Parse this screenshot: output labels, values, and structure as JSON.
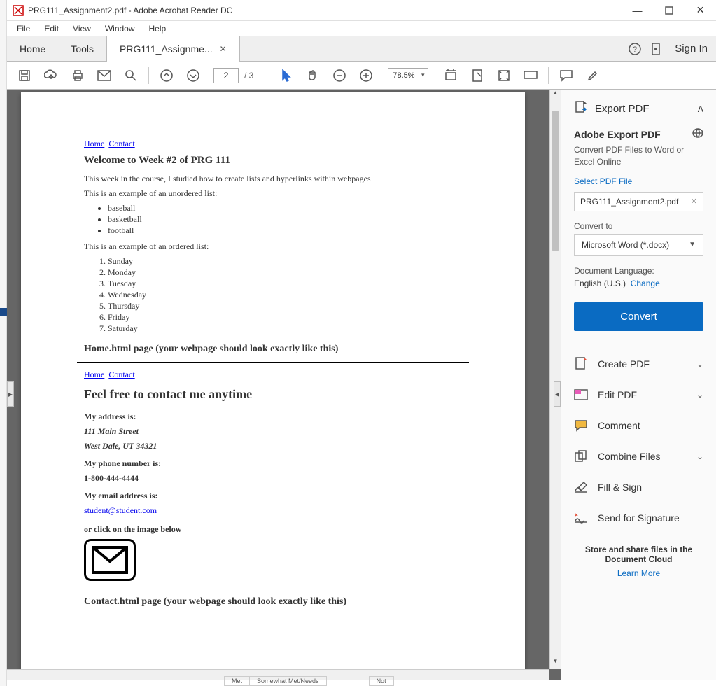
{
  "app": {
    "title": "PRG111_Assignment2.pdf - Adobe Acrobat Reader DC"
  },
  "menus": [
    "File",
    "Edit",
    "View",
    "Window",
    "Help"
  ],
  "tabs": {
    "home": "Home",
    "tools": "Tools",
    "doc": "PRG111_Assignme...",
    "signin": "Sign In"
  },
  "toolbar": {
    "current_page": "2",
    "total_pages": "/ 3",
    "zoom": "78.5%"
  },
  "document": {
    "nav_home": "Home",
    "nav_contact": "Contact",
    "week_heading": "Welcome to Week #2 of PRG 111",
    "week_intro": "This week in the course, I studied how to create lists and hyperlinks within webpages",
    "unordered_intro": "This is an example of an unordered list:",
    "ul_items": [
      "baseball",
      "basketball",
      "football"
    ],
    "ordered_intro": "This is an example of an ordered list:",
    "ol_items": [
      "Sunday",
      "Monday",
      "Tuesday",
      "Wednesday",
      "Thursday",
      "Friday",
      "Saturday"
    ],
    "caption1": "Home.html page (your webpage should look exactly like this)",
    "contact_heading": "Feel free to contact me anytime",
    "addr_label": "My address is:",
    "addr_line1": "111 Main Street",
    "addr_line2": "West Dale, UT 34321",
    "phone_label": "My phone number is:",
    "phone_val": "1-800-444-4444",
    "email_label": "My email address is:",
    "email_val": "student@student.com",
    "img_instruction": "or click on the image below",
    "caption2": "Contact.html page (your webpage should look exactly like this)"
  },
  "rightpanel": {
    "export_head": "Export PDF",
    "export_title": "Adobe Export PDF",
    "export_desc": "Convert PDF Files to Word or Excel Online",
    "select_file": "Select PDF File",
    "file_name": "PRG111_Assignment2.pdf",
    "convert_to_label": "Convert to",
    "convert_to_value": "Microsoft Word (*.docx)",
    "doc_lang_label": "Document Language:",
    "doc_lang_value": "English (U.S.)",
    "change": "Change",
    "convert_btn": "Convert",
    "tools": {
      "create": "Create PDF",
      "edit": "Edit PDF",
      "comment": "Comment",
      "combine": "Combine Files",
      "fillsign": "Fill & Sign",
      "send_sig": "Send for Signature"
    },
    "footer": "Store and share files in the Document Cloud",
    "learn_more": "Learn More"
  },
  "bottom_strip": {
    "met": "Met",
    "somewhat": "Somewhat Met/Needs",
    "not": "Not"
  }
}
